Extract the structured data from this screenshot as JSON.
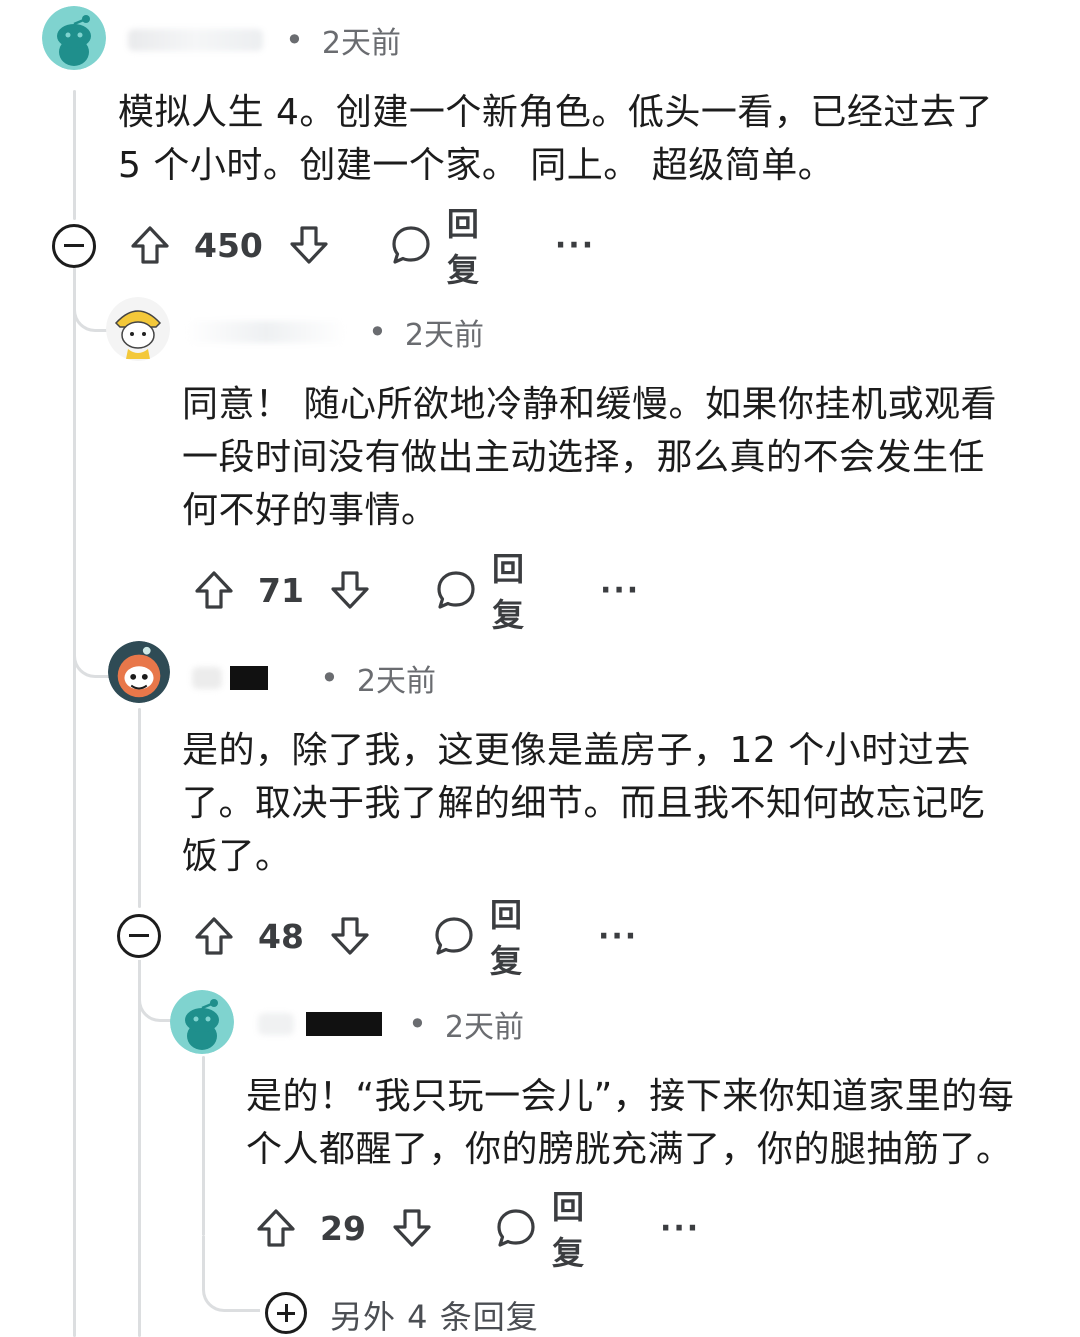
{
  "comments": [
    {
      "time": "2天前",
      "body": [
        "模拟人生 4。创建一个新角色。低头一看，已经过去了",
        "5 个小时。创建一个家。 同上。 超级简单。"
      ],
      "score": "450",
      "reply_label": "回复",
      "more": "···"
    },
    {
      "time": "2天前",
      "body": [
        "同意！ 随心所欲地冷静和缓慢。如果你挂机或观看",
        "一段时间没有做出主动选择，那么真的不会发生任",
        "何不好的事情。"
      ],
      "score": "71",
      "reply_label": "回复",
      "more": "···"
    },
    {
      "time": "2天前",
      "body": [
        "是的，除了我，这更像是盖房子，12 个小时过去",
        "了。取决于我了解的细节。而且我不知何故忘记吃",
        "饭了。"
      ],
      "score": "48",
      "reply_label": "回复",
      "more": "···"
    },
    {
      "time": "2天前",
      "body": [
        "是的！“我只玩一会儿”，接下来你知道家里的每",
        "个人都醒了，你的膀胱充满了，你的腿抽筋了。"
      ],
      "score": "29",
      "reply_label": "回复",
      "more": "···"
    }
  ],
  "more_replies_label": "另外 4 条回复",
  "colors": {
    "thread_line": "#dcdee0",
    "text": "#1c1c1c",
    "muted": "#6a6c70",
    "avatar_teal": "#7fd3cf"
  },
  "icons": [
    "upvote-icon",
    "downvote-icon",
    "comment-bubble-icon",
    "collapse-icon",
    "expand-icon",
    "more-options-icon"
  ]
}
